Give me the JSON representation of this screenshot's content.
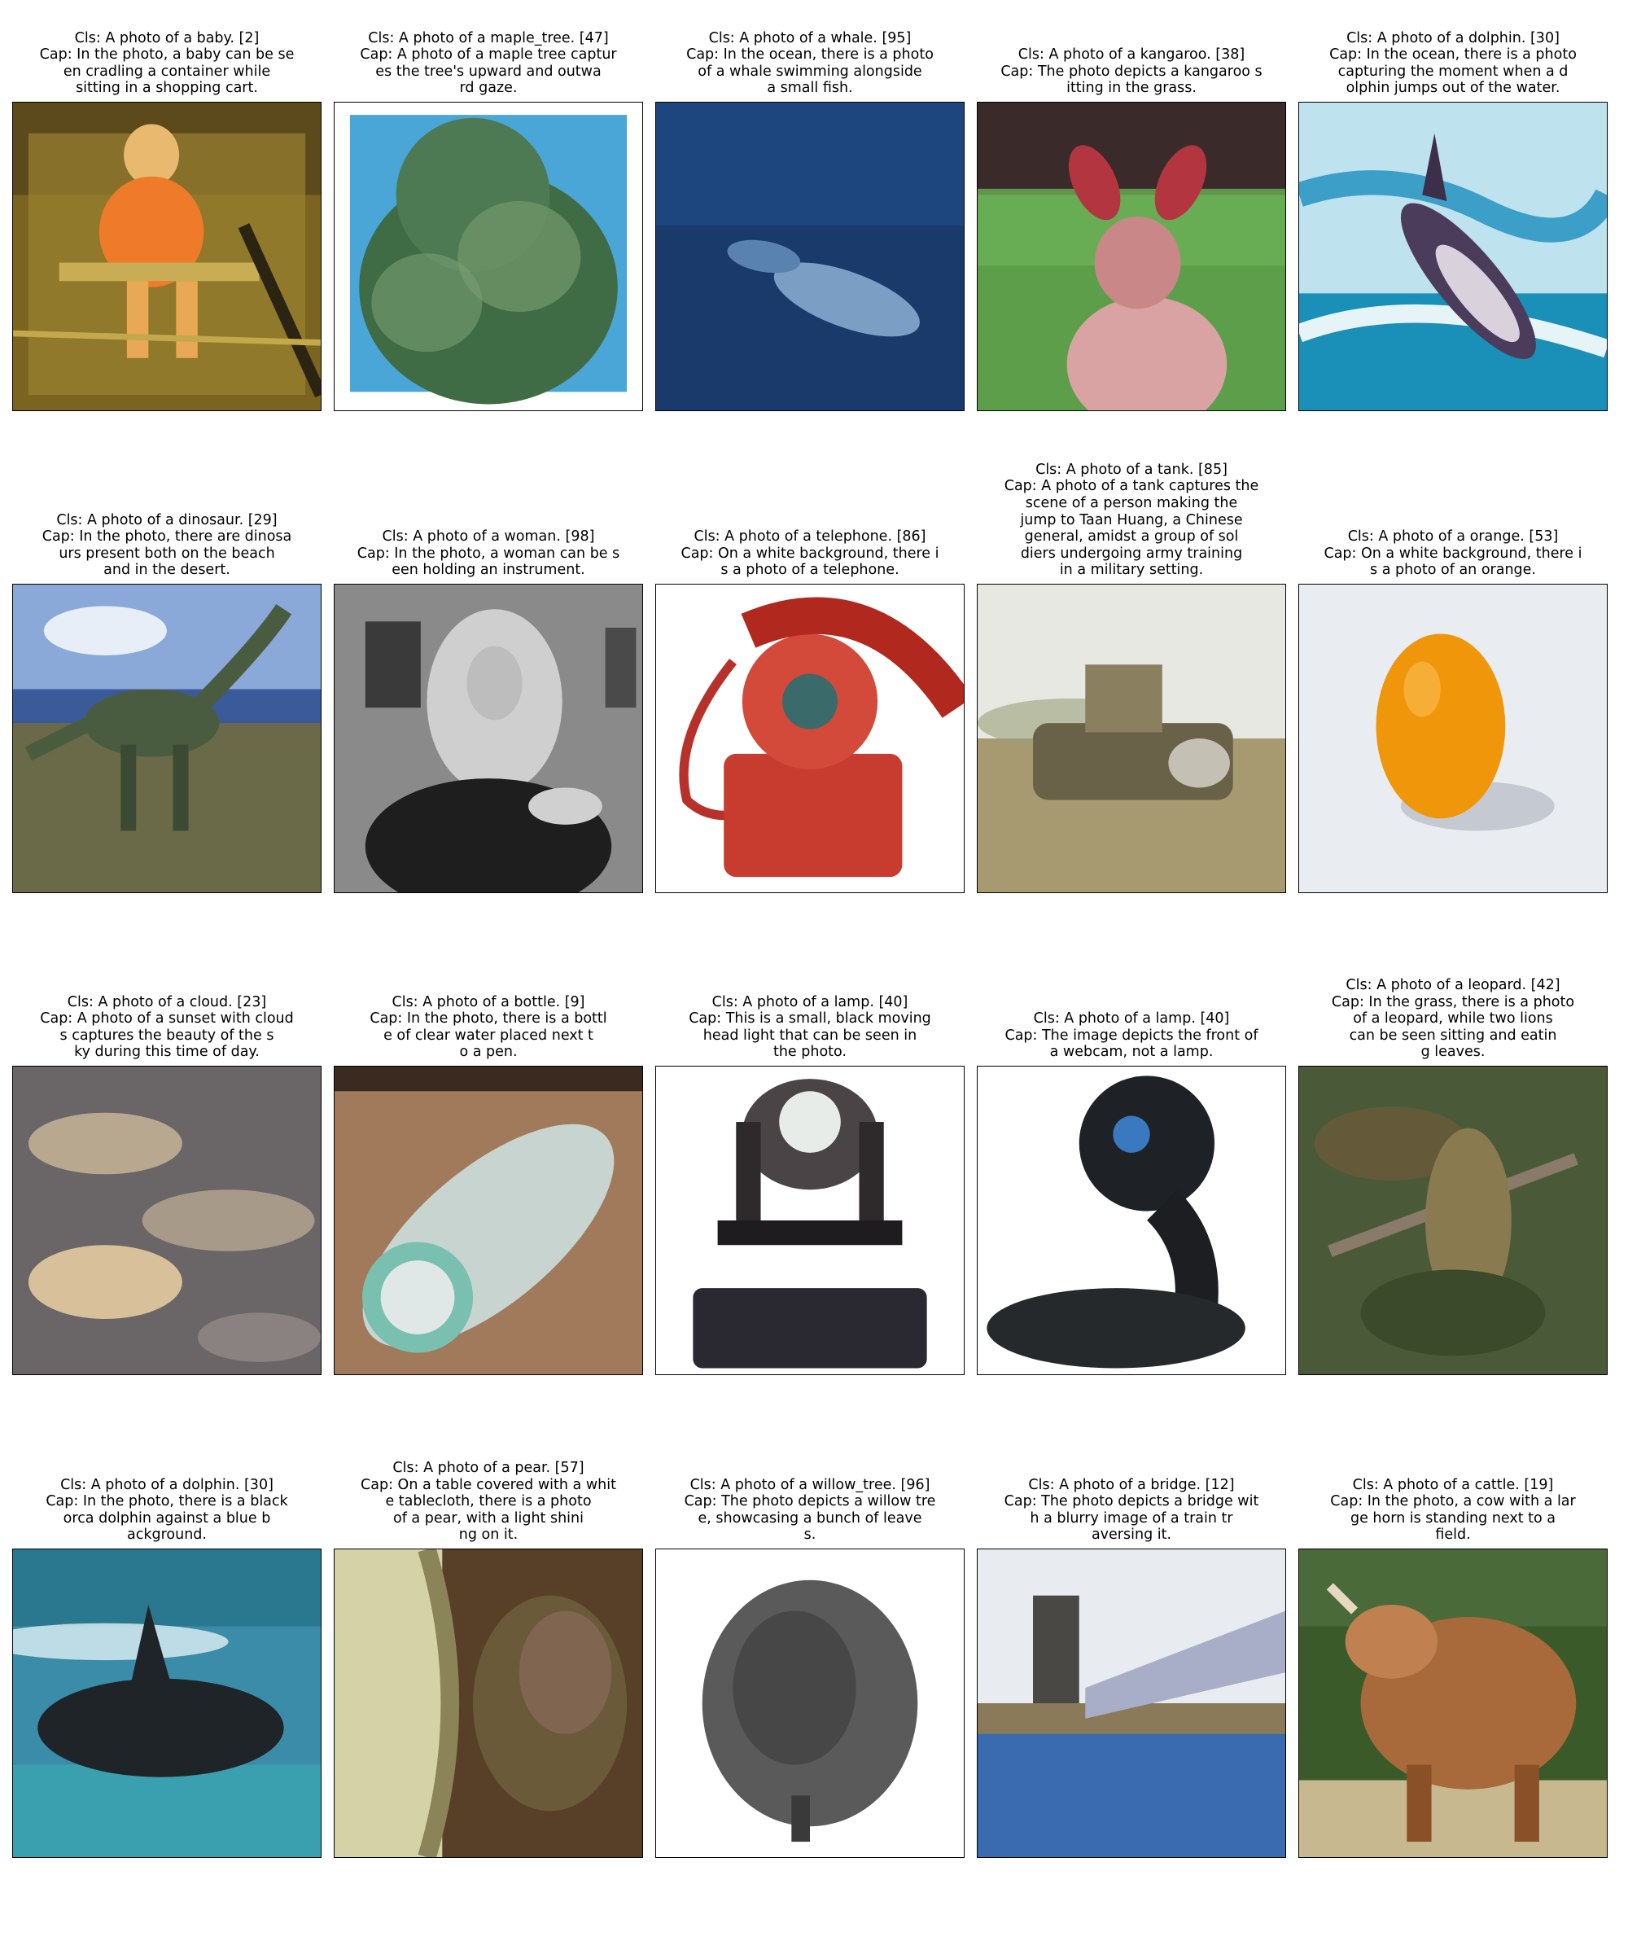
{
  "figure": {
    "panels": [
      {
        "lines": [
          "Cls: A photo of a baby. [2]",
          "Cap: In the photo, a baby can be se",
          "en cradling a container while",
          "sitting in a shopping cart."
        ],
        "scene": "baby"
      },
      {
        "lines": [
          "Cls: A photo of a maple_tree. [47]",
          "Cap: A photo of a maple tree captur",
          "es the tree's upward and outwa",
          "rd gaze."
        ],
        "scene": "maple-tree"
      },
      {
        "lines": [
          "Cls: A photo of a whale. [95]",
          "Cap: In the ocean, there is a photo",
          "of a whale swimming alongside",
          "a small fish."
        ],
        "scene": "whale"
      },
      {
        "lines": [
          "Cls: A photo of a kangaroo. [38]",
          "Cap: The photo depicts a kangaroo s",
          "itting in the grass."
        ],
        "scene": "kangaroo"
      },
      {
        "lines": [
          "Cls: A photo of a dolphin. [30]",
          "Cap: In the ocean, there is a photo",
          "capturing the moment when a d",
          "olphin jumps out of the water."
        ],
        "scene": "dolphin-jump"
      },
      {
        "lines": [
          "Cls: A photo of a dinosaur. [29]",
          "Cap: In the photo, there are dinosa",
          "urs present both on the beach",
          "and in the desert."
        ],
        "scene": "dinosaur"
      },
      {
        "lines": [
          "Cls: A photo of a woman. [98]",
          "Cap: In the photo, a woman can be s",
          "een holding an instrument."
        ],
        "scene": "woman"
      },
      {
        "lines": [
          "Cls: A photo of a telephone. [86]",
          "Cap: On a white background, there i",
          "s a photo of a telephone."
        ],
        "scene": "telephone"
      },
      {
        "lines": [
          "Cls: A photo of a tank. [85]",
          "Cap: A photo of a tank captures the",
          "scene of a person making the",
          "jump to Taan Huang, a Chinese",
          "general, amidst a group of sol",
          "diers undergoing army training",
          "in a military setting."
        ],
        "scene": "tank"
      },
      {
        "lines": [
          "Cls: A photo of a orange. [53]",
          "Cap: On a white background, there i",
          "s a photo of an orange."
        ],
        "scene": "orange"
      },
      {
        "lines": [
          "Cls: A photo of a cloud. [23]",
          "Cap: A photo of a sunset with cloud",
          "s captures the beauty of the s",
          "ky during this time of day."
        ],
        "scene": "cloud"
      },
      {
        "lines": [
          "Cls: A photo of a bottle. [9]",
          "Cap: In the photo, there is a bottl",
          "e of clear water placed next t",
          "o a pen."
        ],
        "scene": "bottle"
      },
      {
        "lines": [
          "Cls: A photo of a lamp. [40]",
          "Cap: This is a small, black moving",
          "head light that can be seen in",
          "the photo."
        ],
        "scene": "lamp"
      },
      {
        "lines": [
          "Cls: A photo of a lamp. [40]",
          "Cap: The image depicts the front of",
          "a webcam, not a lamp."
        ],
        "scene": "webcam"
      },
      {
        "lines": [
          "Cls: A photo of a leopard. [42]",
          "Cap: In the grass, there is a photo",
          "of a leopard, while two lions",
          "can be seen sitting and eatin",
          "g leaves."
        ],
        "scene": "leopard"
      },
      {
        "lines": [
          "Cls: A photo of a dolphin. [30]",
          "Cap: In the photo, there is a black",
          "orca dolphin against a blue b",
          "ackground."
        ],
        "scene": "orca"
      },
      {
        "lines": [
          "Cls: A photo of a pear. [57]",
          "Cap: On a table covered with a whit",
          "e tablecloth, there is a photo",
          "of a pear, with a light shini",
          "ng on it."
        ],
        "scene": "pear"
      },
      {
        "lines": [
          "Cls: A photo of a willow_tree. [96]",
          "Cap: The photo depicts a willow tre",
          "e, showcasing a bunch of leave",
          "s."
        ],
        "scene": "willow-tree"
      },
      {
        "lines": [
          "Cls: A photo of a bridge. [12]",
          "Cap: The photo depicts a bridge wit",
          "h a blurry image of a train tr",
          "aversing it."
        ],
        "scene": "bridge"
      },
      {
        "lines": [
          "Cls: A photo of a cattle. [19]",
          "Cap: In the photo, a cow with a lar",
          "ge horn is standing next to a",
          "field."
        ],
        "scene": "cattle"
      }
    ]
  }
}
